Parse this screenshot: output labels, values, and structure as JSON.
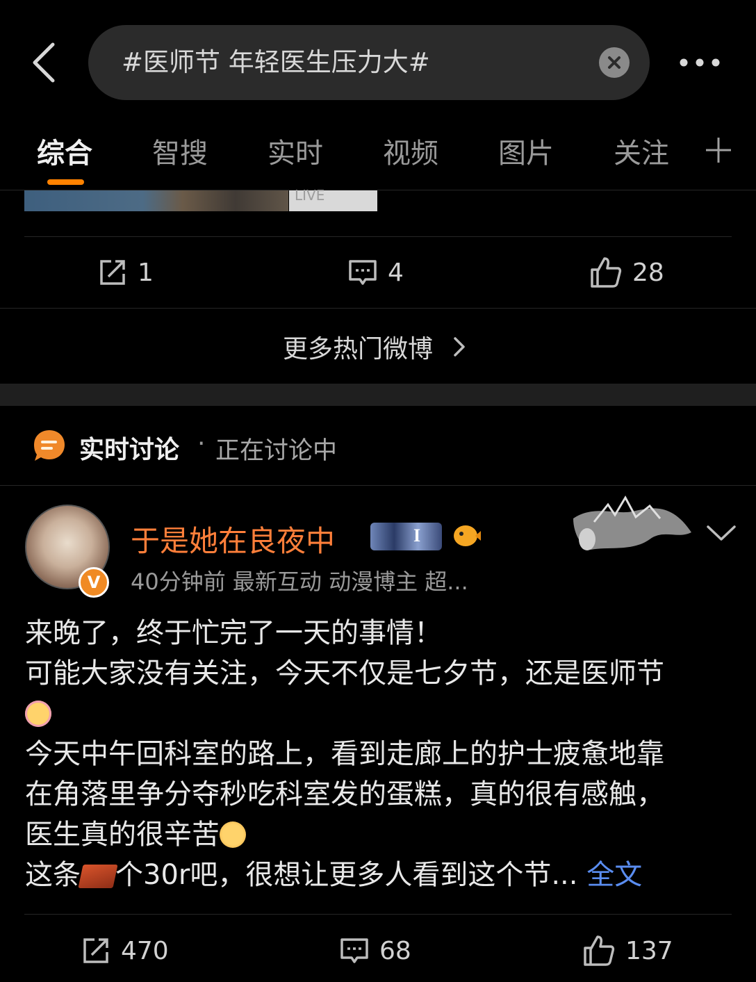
{
  "search": {
    "query": "#医师节 年轻医生压力大#"
  },
  "tabs": [
    "综合",
    "智搜",
    "实时",
    "视频",
    "图片",
    "关注"
  ],
  "thumb": {
    "live_label": "LIVE"
  },
  "prev_post_actions": {
    "repost": "1",
    "comment": "4",
    "like": "28"
  },
  "more_link": {
    "label": "更多热门微博"
  },
  "section": {
    "title": "实时讨论",
    "separator": "·",
    "subtitle": "正在讨论中"
  },
  "post": {
    "username": "于是她在良夜中",
    "meta": "40分钟前  最新互动  动漫博主 超...",
    "verified_mark": "V",
    "badge_letter": "I",
    "lines": [
      "来晚了，终于忙完了一天的事情！",
      "可能大家没有关注，今天不仅是七夕节，还是医师节",
      "",
      "今天中午回科室的路上，看到走廊上的护士疲惫地靠",
      "在角落里争分夺秒吃科室发的蛋糕，真的很有感触，",
      "医生真的很辛苦",
      "这条",
      "个30r吧，很想让更多人看到这个节..."
    ],
    "full_text_label": "全文",
    "actions": {
      "repost": "470",
      "comment": "68",
      "like": "137"
    }
  },
  "colors": {
    "accent": "#ff8200",
    "username": "#ff7f3a",
    "link": "#5a8df0"
  },
  "icons": [
    "back-arrow-icon",
    "clear-icon",
    "more-dots-icon",
    "plus-icon",
    "repost-icon",
    "comment-icon",
    "like-icon",
    "chevron-right-icon",
    "discussion-icon",
    "chevron-down-icon"
  ]
}
